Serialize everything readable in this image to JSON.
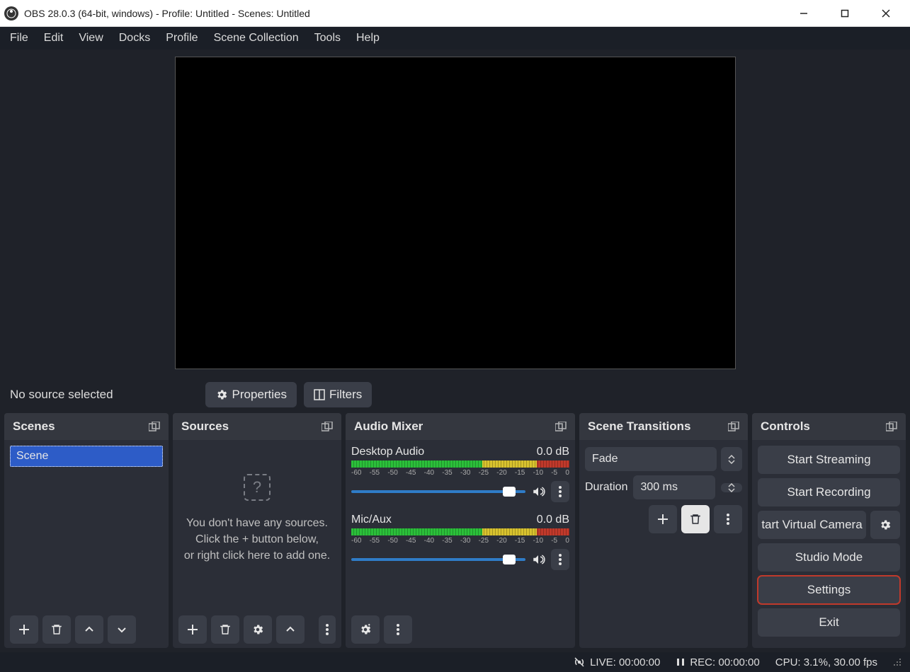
{
  "titlebar": {
    "title": "OBS 28.0.3 (64-bit, windows) - Profile: Untitled - Scenes: Untitled"
  },
  "menu": {
    "file": "File",
    "edit": "Edit",
    "view": "View",
    "docks": "Docks",
    "profile": "Profile",
    "scene_collection": "Scene Collection",
    "tools": "Tools",
    "help": "Help"
  },
  "infobar": {
    "no_source": "No source selected",
    "properties": "Properties",
    "filters": "Filters"
  },
  "panels": {
    "scenes": {
      "title": "Scenes",
      "items": [
        {
          "name": "Scene"
        }
      ]
    },
    "sources": {
      "title": "Sources",
      "empty_line1": "You don't have any sources.",
      "empty_line2": "Click the + button below,",
      "empty_line3": "or right click here to add one."
    },
    "mixer": {
      "title": "Audio Mixer",
      "ticks": [
        "-60",
        "-55",
        "-50",
        "-45",
        "-40",
        "-35",
        "-30",
        "-25",
        "-20",
        "-15",
        "-10",
        "-5",
        "0"
      ],
      "channels": [
        {
          "name": "Desktop Audio",
          "db": "0.0 dB"
        },
        {
          "name": "Mic/Aux",
          "db": "0.0 dB"
        }
      ]
    },
    "transitions": {
      "title": "Scene Transitions",
      "selected": "Fade",
      "duration_label": "Duration",
      "duration_value": "300 ms"
    },
    "controls": {
      "title": "Controls",
      "start_streaming": "Start Streaming",
      "start_recording": "Start Recording",
      "virtual_camera": "tart Virtual Camera",
      "studio_mode": "Studio Mode",
      "settings": "Settings",
      "exit": "Exit"
    }
  },
  "status": {
    "live": "LIVE: 00:00:00",
    "rec": "REC: 00:00:00",
    "cpu": "CPU: 3.1%, 30.00 fps"
  }
}
